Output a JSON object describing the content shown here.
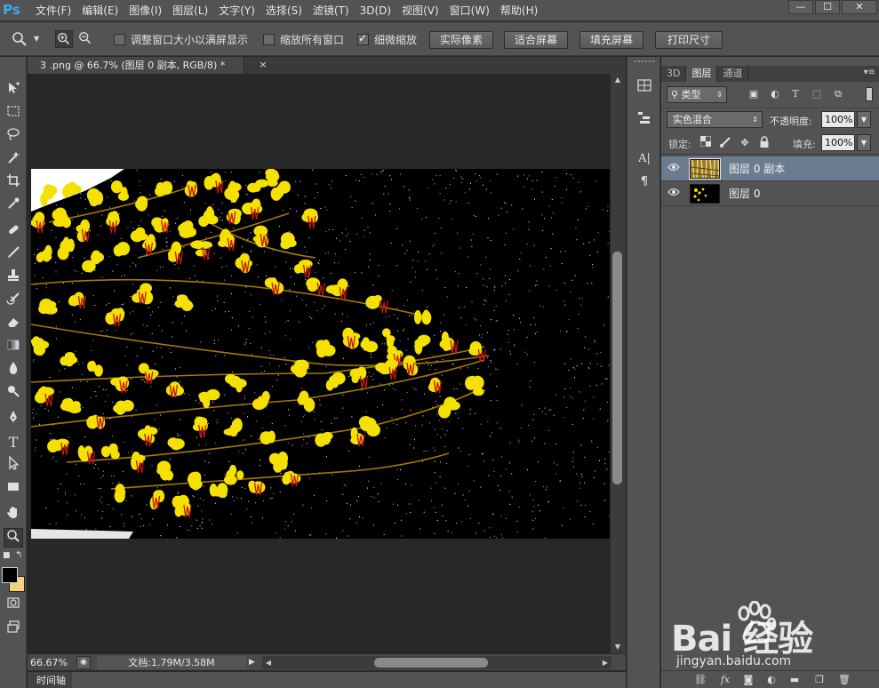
{
  "app": {
    "logo": "Ps",
    "menus": [
      "文件(F)",
      "编辑(E)",
      "图像(I)",
      "图层(L)",
      "文字(Y)",
      "选择(S)",
      "滤镜(T)",
      "3D(D)",
      "视图(V)",
      "窗口(W)",
      "帮助(H)"
    ],
    "window_buttons": [
      "—",
      "☐",
      "✕"
    ]
  },
  "options": {
    "zoom_tool_glyph": "🔍",
    "resize_windows_label": "调整窗口大小以满屏显示",
    "resize_windows_checked": false,
    "zoom_all_label": "缩放所有窗口",
    "zoom_all_checked": false,
    "scrubby_label": "细微缩放",
    "scrubby_checked": true,
    "buttons": [
      "实际像素",
      "适合屏幕",
      "填充屏幕",
      "打印尺寸"
    ]
  },
  "document": {
    "tab_title": "3 .png @ 66.7% (图层 0 副本, RGB/8) *",
    "close_glyph": "×"
  },
  "status": {
    "zoom": "66.67%",
    "doc_info": "文档:1.79M/3.58M",
    "timeline_tab": "时间轴"
  },
  "panel": {
    "tabs": [
      "3D",
      "图层",
      "通道"
    ],
    "active_tab": "图层",
    "filter_type": "类型",
    "blend_mode": "实色混合",
    "opacity_label": "不透明度:",
    "opacity_value": "100%",
    "lock_label": "锁定:",
    "fill_label": "填充:",
    "fill_value": "100%",
    "layers": [
      {
        "name": "图层 0 副本",
        "selected": true,
        "visible": true
      },
      {
        "name": "图层 0",
        "selected": false,
        "visible": true
      }
    ],
    "footer_icons": [
      "link-icon",
      "fx-icon",
      "mask-icon",
      "adjustment-icon",
      "group-icon",
      "new-layer-icon",
      "trash-icon"
    ]
  },
  "watermark": {
    "brand": "Bai  经验",
    "url": "jingyan.baidu.com"
  },
  "colors": {
    "foreground": "#000000",
    "background": "#f5d27a",
    "selected_layer": "#6b7c8f",
    "flower_yellow": "#f5e100"
  }
}
